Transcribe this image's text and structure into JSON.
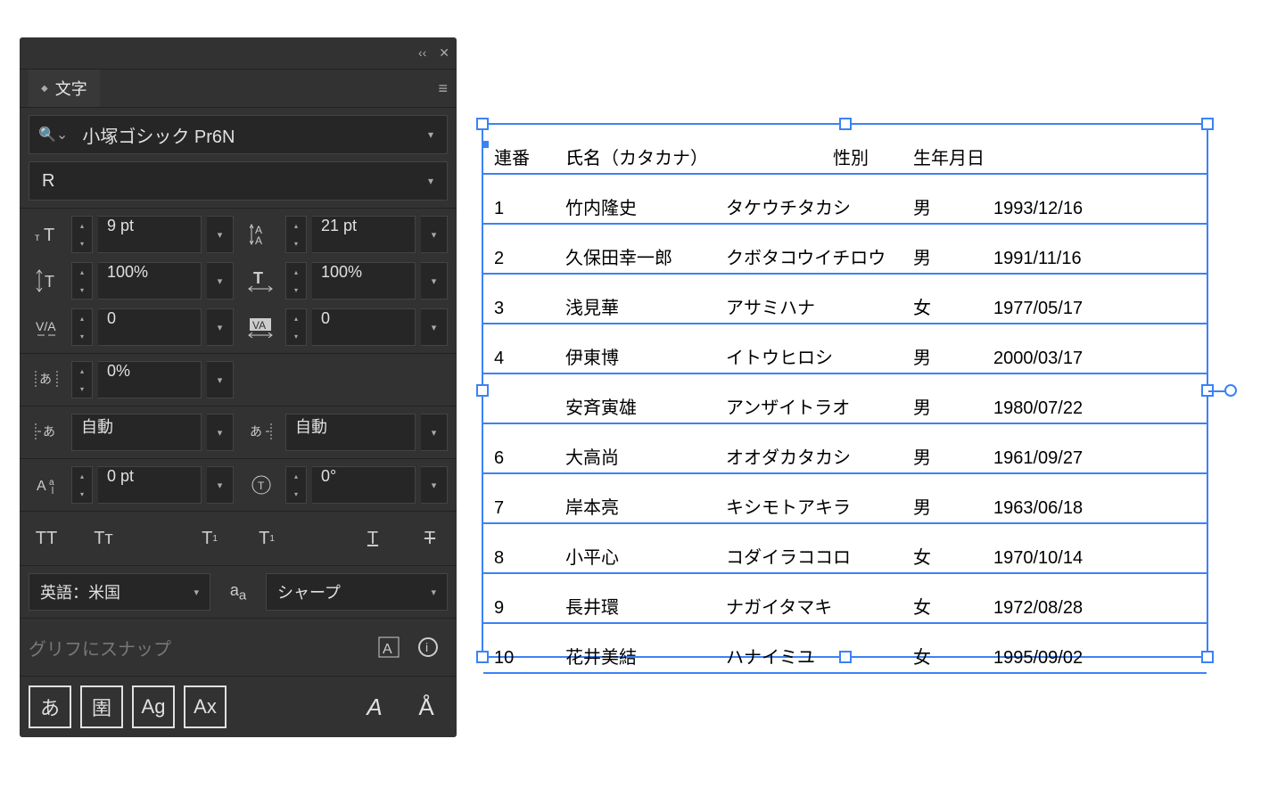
{
  "panel": {
    "title": "文字",
    "font_family": "小塚ゴシック Pr6N",
    "font_style": "R",
    "size": "9 pt",
    "leading": "21 pt",
    "v_scale": "100%",
    "h_scale": "100%",
    "kerning": "0",
    "tracking": "0",
    "tsume": "0%",
    "aki_before": "自動",
    "aki_after": "自動",
    "baseline_shift": "0 pt",
    "rotation": "0°",
    "language": "英語：米国",
    "antialiasing": "シャープ",
    "snap_label": "グリフにスナップ"
  },
  "table": {
    "headers": {
      "num": "連番",
      "name": "氏名",
      "kana": "氏名（カタカナ）",
      "sex": "性別",
      "date": "生年月日"
    },
    "rows": [
      {
        "num": "1",
        "name": "竹内隆史",
        "kana": "タケウチタカシ",
        "sex": "男",
        "date": "1993/12/16"
      },
      {
        "num": "2",
        "name": "久保田幸一郎",
        "kana": "クボタコウイチロウ",
        "sex": "男",
        "date": "1991/11/16"
      },
      {
        "num": "3",
        "name": "浅見華",
        "kana": "アサミハナ",
        "sex": "女",
        "date": "1977/05/17"
      },
      {
        "num": "4",
        "name": "伊東博",
        "kana": "イトウヒロシ",
        "sex": "男",
        "date": "2000/03/17"
      },
      {
        "num": "",
        "name": "安斉寅雄",
        "kana": "アンザイトラオ",
        "sex": "男",
        "date": "1980/07/22"
      },
      {
        "num": "6",
        "name": "大高尚",
        "kana": "オオダカタカシ",
        "sex": "男",
        "date": "1961/09/27"
      },
      {
        "num": "7",
        "name": "岸本亮",
        "kana": "キシモトアキラ",
        "sex": "男",
        "date": "1963/06/18"
      },
      {
        "num": "8",
        "name": "小平心",
        "kana": "コダイラココロ",
        "sex": "女",
        "date": "1970/10/14"
      },
      {
        "num": "9",
        "name": "長井環",
        "kana": "ナガイタマキ",
        "sex": "女",
        "date": "1972/08/28"
      },
      {
        "num": "10",
        "name": "花井美結",
        "kana": "ハナイミユ",
        "sex": "女",
        "date": "1995/09/02"
      }
    ]
  }
}
